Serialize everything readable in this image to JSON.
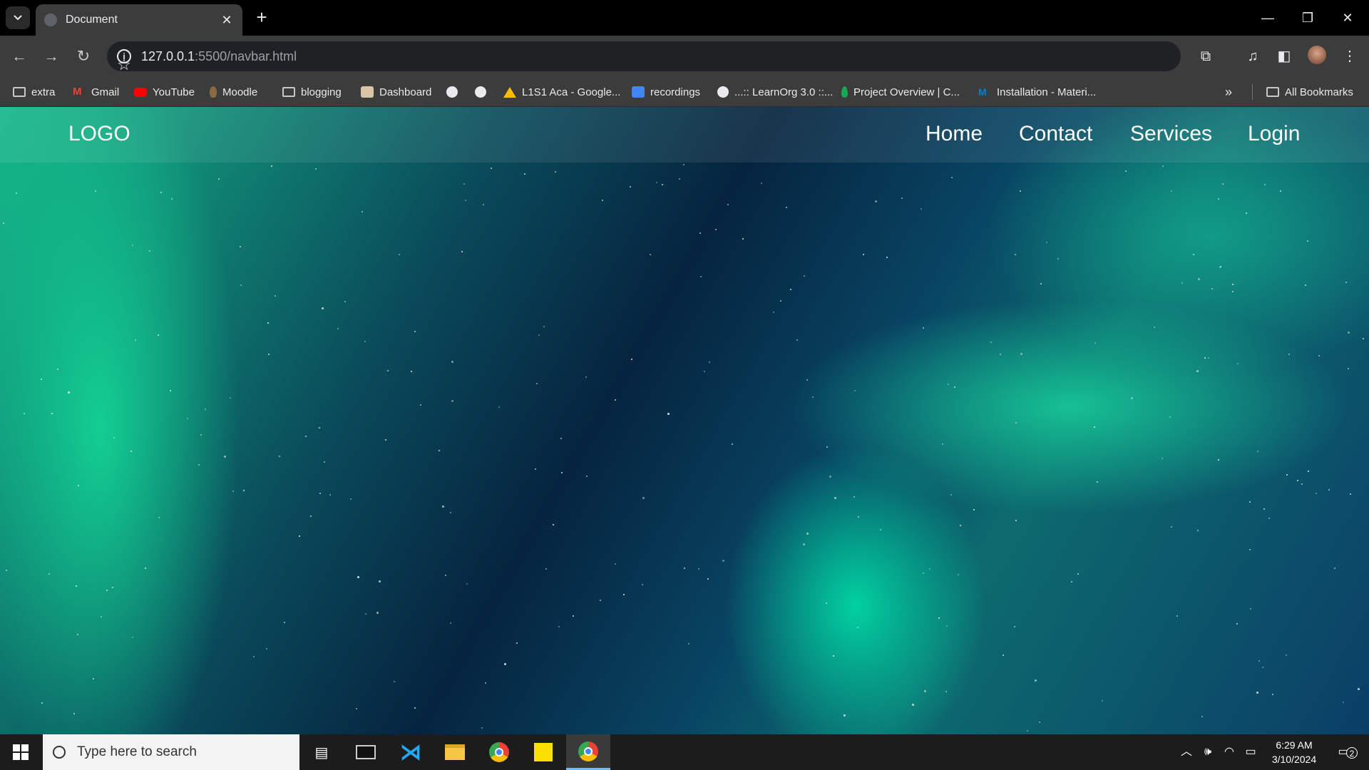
{
  "browser": {
    "tab_title": "Document",
    "url_host": "127.0.0.1",
    "url_path": ":5500/navbar.html"
  },
  "bookmarks": [
    {
      "label": "extra",
      "icon": "folder-icon"
    },
    {
      "label": "Gmail",
      "icon": "gmail-icon"
    },
    {
      "label": "YouTube",
      "icon": "youtube-icon"
    },
    {
      "label": "Moodle",
      "icon": "moodle-icon"
    },
    {
      "label": "blogging",
      "icon": "folder-icon"
    },
    {
      "label": "Dashboard",
      "icon": "dashboard-icon"
    },
    {
      "label": "",
      "icon": "globe-icon"
    },
    {
      "label": "",
      "icon": "globe-icon"
    },
    {
      "label": "L1S1 Aca - Google...",
      "icon": "google-drive-icon"
    },
    {
      "label": "recordings",
      "icon": "user-icon"
    },
    {
      "label": "...:: LearnOrg 3.0 ::...",
      "icon": "globe-icon"
    },
    {
      "label": "Project Overview | C...",
      "icon": "mongodb-icon"
    },
    {
      "label": "Installation - Materi...",
      "icon": "mui-icon"
    }
  ],
  "all_bookmarks_label": "All Bookmarks",
  "navbar": {
    "logo": "LOGO",
    "links": [
      "Home",
      "Contact",
      "Services",
      "Login"
    ]
  },
  "taskbar": {
    "search_placeholder": "Type here to search",
    "time": "6:29 AM",
    "date": "3/10/2024",
    "notification_count": "2"
  },
  "colors": {
    "aurora_green": "#15b98a",
    "night_blue": "#06243f",
    "browser_chrome": "#3c3c3c"
  }
}
